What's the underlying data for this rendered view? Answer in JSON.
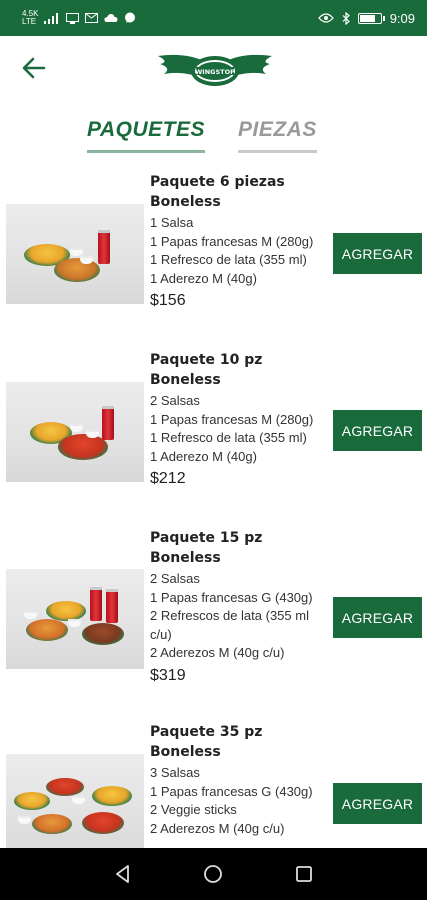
{
  "status_bar": {
    "time": "9:09",
    "carrier_small": "LTE",
    "network_small": "4.5K"
  },
  "header": {
    "back_icon": "back-arrow-icon",
    "logo_text": "WINGSTOP"
  },
  "tabs": [
    {
      "label": "PAQUETES",
      "active": true
    },
    {
      "label": "PIEZAS",
      "active": false
    }
  ],
  "products": [
    {
      "title": "Paquete 6 piezas Boneless",
      "lines": [
        "1 Salsa",
        "1 Papas francesas M (280g)",
        "1 Refresco de lata (355 ml)",
        "1 Aderezo M (40g)"
      ],
      "price": "$156",
      "button": "AGREGAR"
    },
    {
      "title": "Paquete 10 pz Boneless",
      "lines": [
        "2 Salsas",
        "1 Papas francesas M (280g)",
        "1 Refresco de lata (355 ml)",
        "1 Aderezo M (40g)"
      ],
      "price": "$212",
      "button": "AGREGAR"
    },
    {
      "title": "Paquete 15 pz Boneless",
      "lines": [
        "2 Salsas",
        "1 Papas francesas G (430g)",
        "2 Refrescos de lata (355 ml c/u)",
        "2 Aderezos M (40g c/u)"
      ],
      "price": "$319",
      "button": "AGREGAR"
    },
    {
      "title": "Paquete 35 pz Boneless",
      "lines": [
        "3 Salsas",
        "1 Papas francesas G (430g)",
        "2 Veggie sticks",
        "2 Aderezos M (40g c/u)"
      ],
      "price": "",
      "button": "AGREGAR"
    }
  ],
  "colors": {
    "brand_green": "#1a6b3c",
    "inactive_tab": "#9a9a9a"
  }
}
